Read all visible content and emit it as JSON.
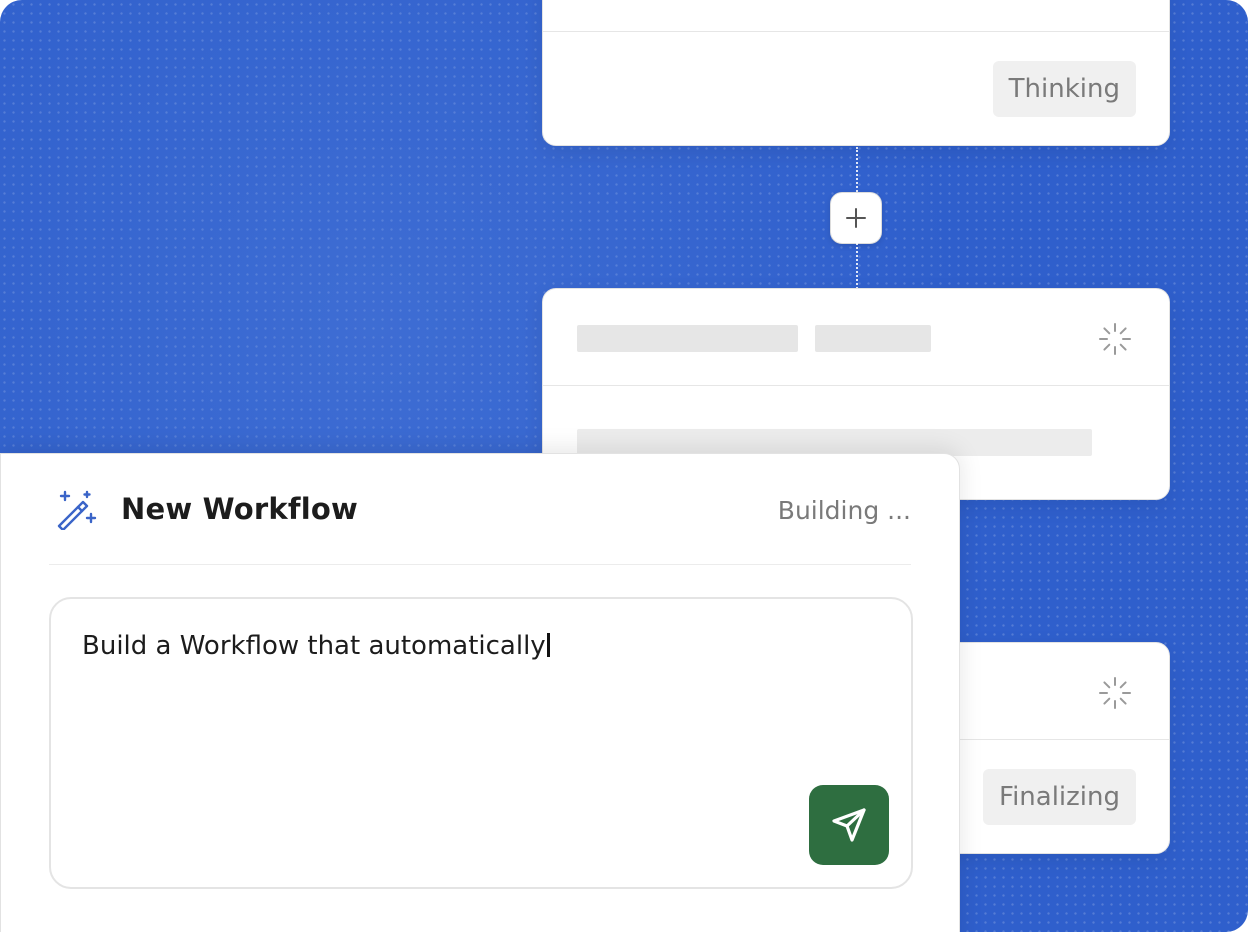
{
  "workflow_steps": {
    "step1_status": "Thinking",
    "step3_status": "Finalizing",
    "add_step_icon": "plus-icon",
    "loading_icon": "spinner-icon"
  },
  "panel": {
    "icon": "magic-wand-icon",
    "title": "New Workflow",
    "status": "Building ...",
    "prompt_value": "Build a Workflow that automatically",
    "send_icon": "send-icon"
  },
  "colors": {
    "background_blue": "#2f5fcc",
    "send_button_green": "#2e6e40",
    "icon_blue": "#3a64c8"
  }
}
